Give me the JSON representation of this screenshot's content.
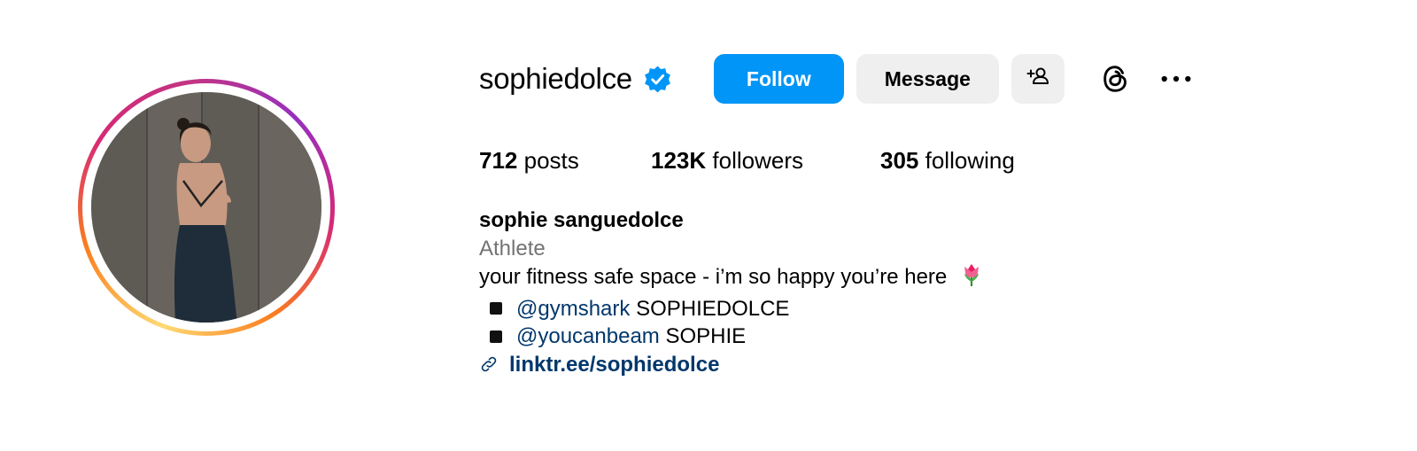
{
  "profile": {
    "username": "sophiedolce",
    "verified_icon": "verified-badge-icon",
    "full_name": "sophie sanguedolce",
    "category": "Athlete"
  },
  "actions": {
    "follow_label": "Follow",
    "message_label": "Message",
    "add_user_icon": "add-person-icon",
    "threads_icon": "threads-icon",
    "more_icon": "more-options-icon"
  },
  "stats": {
    "posts_count": "712",
    "posts_label": "posts",
    "followers_count": "123K",
    "followers_label": "followers",
    "following_count": "305",
    "following_label": "following"
  },
  "bio": {
    "line1": "your fitness safe space - i’m so happy you’re here",
    "line1_emoji": "tulip-icon",
    "items": [
      {
        "mention": "@gymshark",
        "text": "SOPHIEDOLCE"
      },
      {
        "mention": "@youcanbeam",
        "text": "SOPHIE"
      }
    ],
    "link": "linktr.ee/sophiedolce"
  },
  "colors": {
    "follow_button": "#0095f6",
    "secondary_button": "#efefef",
    "link": "#00376b",
    "category_text": "#737373",
    "verified": "#0095f6"
  }
}
